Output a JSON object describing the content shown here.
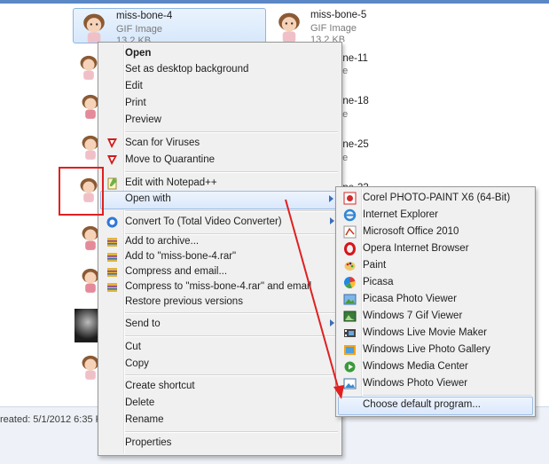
{
  "files": [
    {
      "name": "miss-bone-4",
      "type": "GIF Image",
      "size": "13.2 KB"
    },
    {
      "name": "miss-bone-5",
      "type": "GIF Image",
      "size": "13.2 KB"
    }
  ],
  "peek_labels": [
    "ge",
    "one-11",
    "ge",
    "one-18",
    "ge",
    "one-25",
    "ge",
    "one-33"
  ],
  "status_bar": {
    "created": "reated: 5/1/2012 6:35 PM"
  },
  "context_menu": {
    "items": [
      "Open",
      "Set as desktop background",
      "Edit",
      "Print",
      "Preview",
      "Scan for Viruses",
      "Move to Quarantine",
      "Edit with Notepad++",
      "Open with",
      "Convert To (Total Video Converter)",
      "Add to archive...",
      "Add to \"miss-bone-4.rar\"",
      "Compress and email...",
      "Compress to \"miss-bone-4.rar\" and email",
      "Restore previous versions",
      "Send to",
      "Cut",
      "Copy",
      "Create shortcut",
      "Delete",
      "Rename",
      "Properties"
    ]
  },
  "open_with_menu": {
    "items": [
      "Corel PHOTO-PAINT X6 (64-Bit)",
      "Internet Explorer",
      "Microsoft Office 2010",
      "Opera Internet Browser",
      "Paint",
      "Picasa",
      "Picasa Photo Viewer",
      "Windows 7 Gif Viewer",
      "Windows Live Movie Maker",
      "Windows Live Photo Gallery",
      "Windows Media Center",
      "Windows Photo Viewer",
      "Choose default program..."
    ]
  },
  "colors": {
    "annotation": "#e02020",
    "accent": "#3b6fb6",
    "title_bar": "#5b87c5"
  },
  "icons": {
    "open_with_arrow": "chevron-right-icon",
    "scan": "antivirus-icon",
    "notepad": "notepad-icon",
    "converter": "converter-icon",
    "archive": "winrar-icon"
  }
}
